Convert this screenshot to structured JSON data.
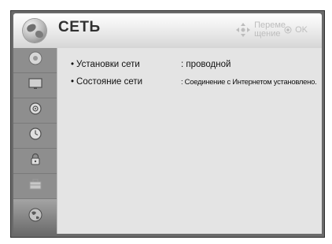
{
  "header": {
    "title": "СЕТЬ",
    "hint_move": "Переме щение",
    "hint_ok": "OK"
  },
  "sidebar": {
    "items": [
      {
        "icon": "picture-icon",
        "label": "",
        "active": false
      },
      {
        "icon": "screen-icon",
        "label": "",
        "active": false
      },
      {
        "icon": "audio-icon",
        "label": "",
        "active": false
      },
      {
        "icon": "clock-icon",
        "label": "",
        "active": false
      },
      {
        "icon": "lock-icon",
        "label": "",
        "active": false
      },
      {
        "icon": "options-icon",
        "label": "",
        "active": false
      },
      {
        "icon": "network-icon",
        "label": "",
        "active": true
      }
    ]
  },
  "main": {
    "rows": [
      {
        "label": "Установки сети",
        "value": ": проводной"
      },
      {
        "label": "Состояние сети",
        "value": ": Соединение с Интернетом установлено."
      }
    ]
  },
  "colors": {
    "frame": "#6a6a6a",
    "sidebar": "#8e8e8e",
    "content": "#e4e4e4",
    "title": "#303030"
  }
}
